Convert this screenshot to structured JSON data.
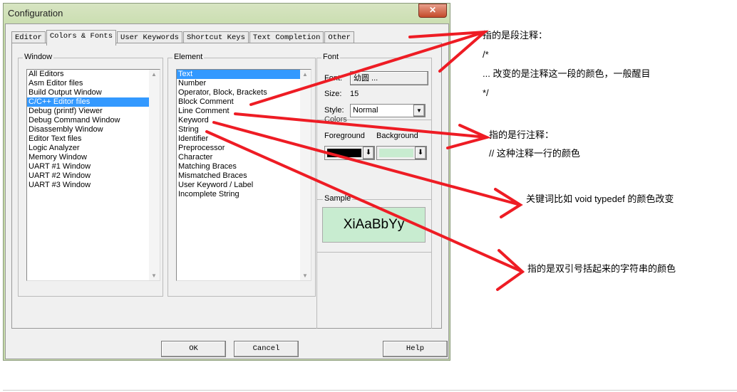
{
  "window": {
    "title": "Configuration"
  },
  "tabs": [
    "Editor",
    "Colors & Fonts",
    "User Keywords",
    "Shortcut Keys",
    "Text Completion",
    "Other"
  ],
  "window_group": {
    "label": "Window",
    "items": [
      "All Editors",
      "Asm Editor files",
      "Build Output Window",
      "C/C++ Editor files",
      "Debug (printf) Viewer",
      "Debug Command Window",
      "Disassembly Window",
      "Editor Text files",
      "Logic Analyzer",
      "Memory Window",
      "UART #1 Window",
      "UART #2 Window",
      "UART #3 Window"
    ],
    "selected": "C/C++ Editor files"
  },
  "element_group": {
    "label": "Element",
    "items": [
      "Text",
      "Number",
      "Operator, Block, Brackets",
      "Block Comment",
      "Line Comment",
      "Keyword",
      "String",
      "Identifier",
      "Preprocessor",
      "Character",
      "Matching Braces",
      "Mismatched Braces",
      "User Keyword / Label",
      "Incomplete String"
    ],
    "selected": "Text"
  },
  "font_group": {
    "label": "Font",
    "font_label": "Font:",
    "font_value": "幼圆 ...",
    "size_label": "Size:",
    "size_value": "15",
    "style_label": "Style:",
    "style_value": "Normal"
  },
  "colors_group": {
    "label": "Colors",
    "foreground_label": "Foreground",
    "background_label": "Background",
    "foreground": "#000000",
    "background": "#c8ecd0"
  },
  "sample": {
    "label": "Sample",
    "text": "XiAaBbYy"
  },
  "buttons": {
    "ok": "OK",
    "cancel": "Cancel",
    "help": "Help"
  },
  "annotations": {
    "block": [
      "指的是段注释：",
      "/*",
      "...   改变的是注释这一段的颜色，一般醒目",
      "*/"
    ],
    "line": [
      "指的是行注释：",
      "//   这种注释一行的颜色"
    ],
    "keyword": "关键词比如  void  typedef 的颜色改变",
    "string": "指的是双引号括起来的字符串的颜色",
    "arrow_color": "#ee1c24"
  }
}
